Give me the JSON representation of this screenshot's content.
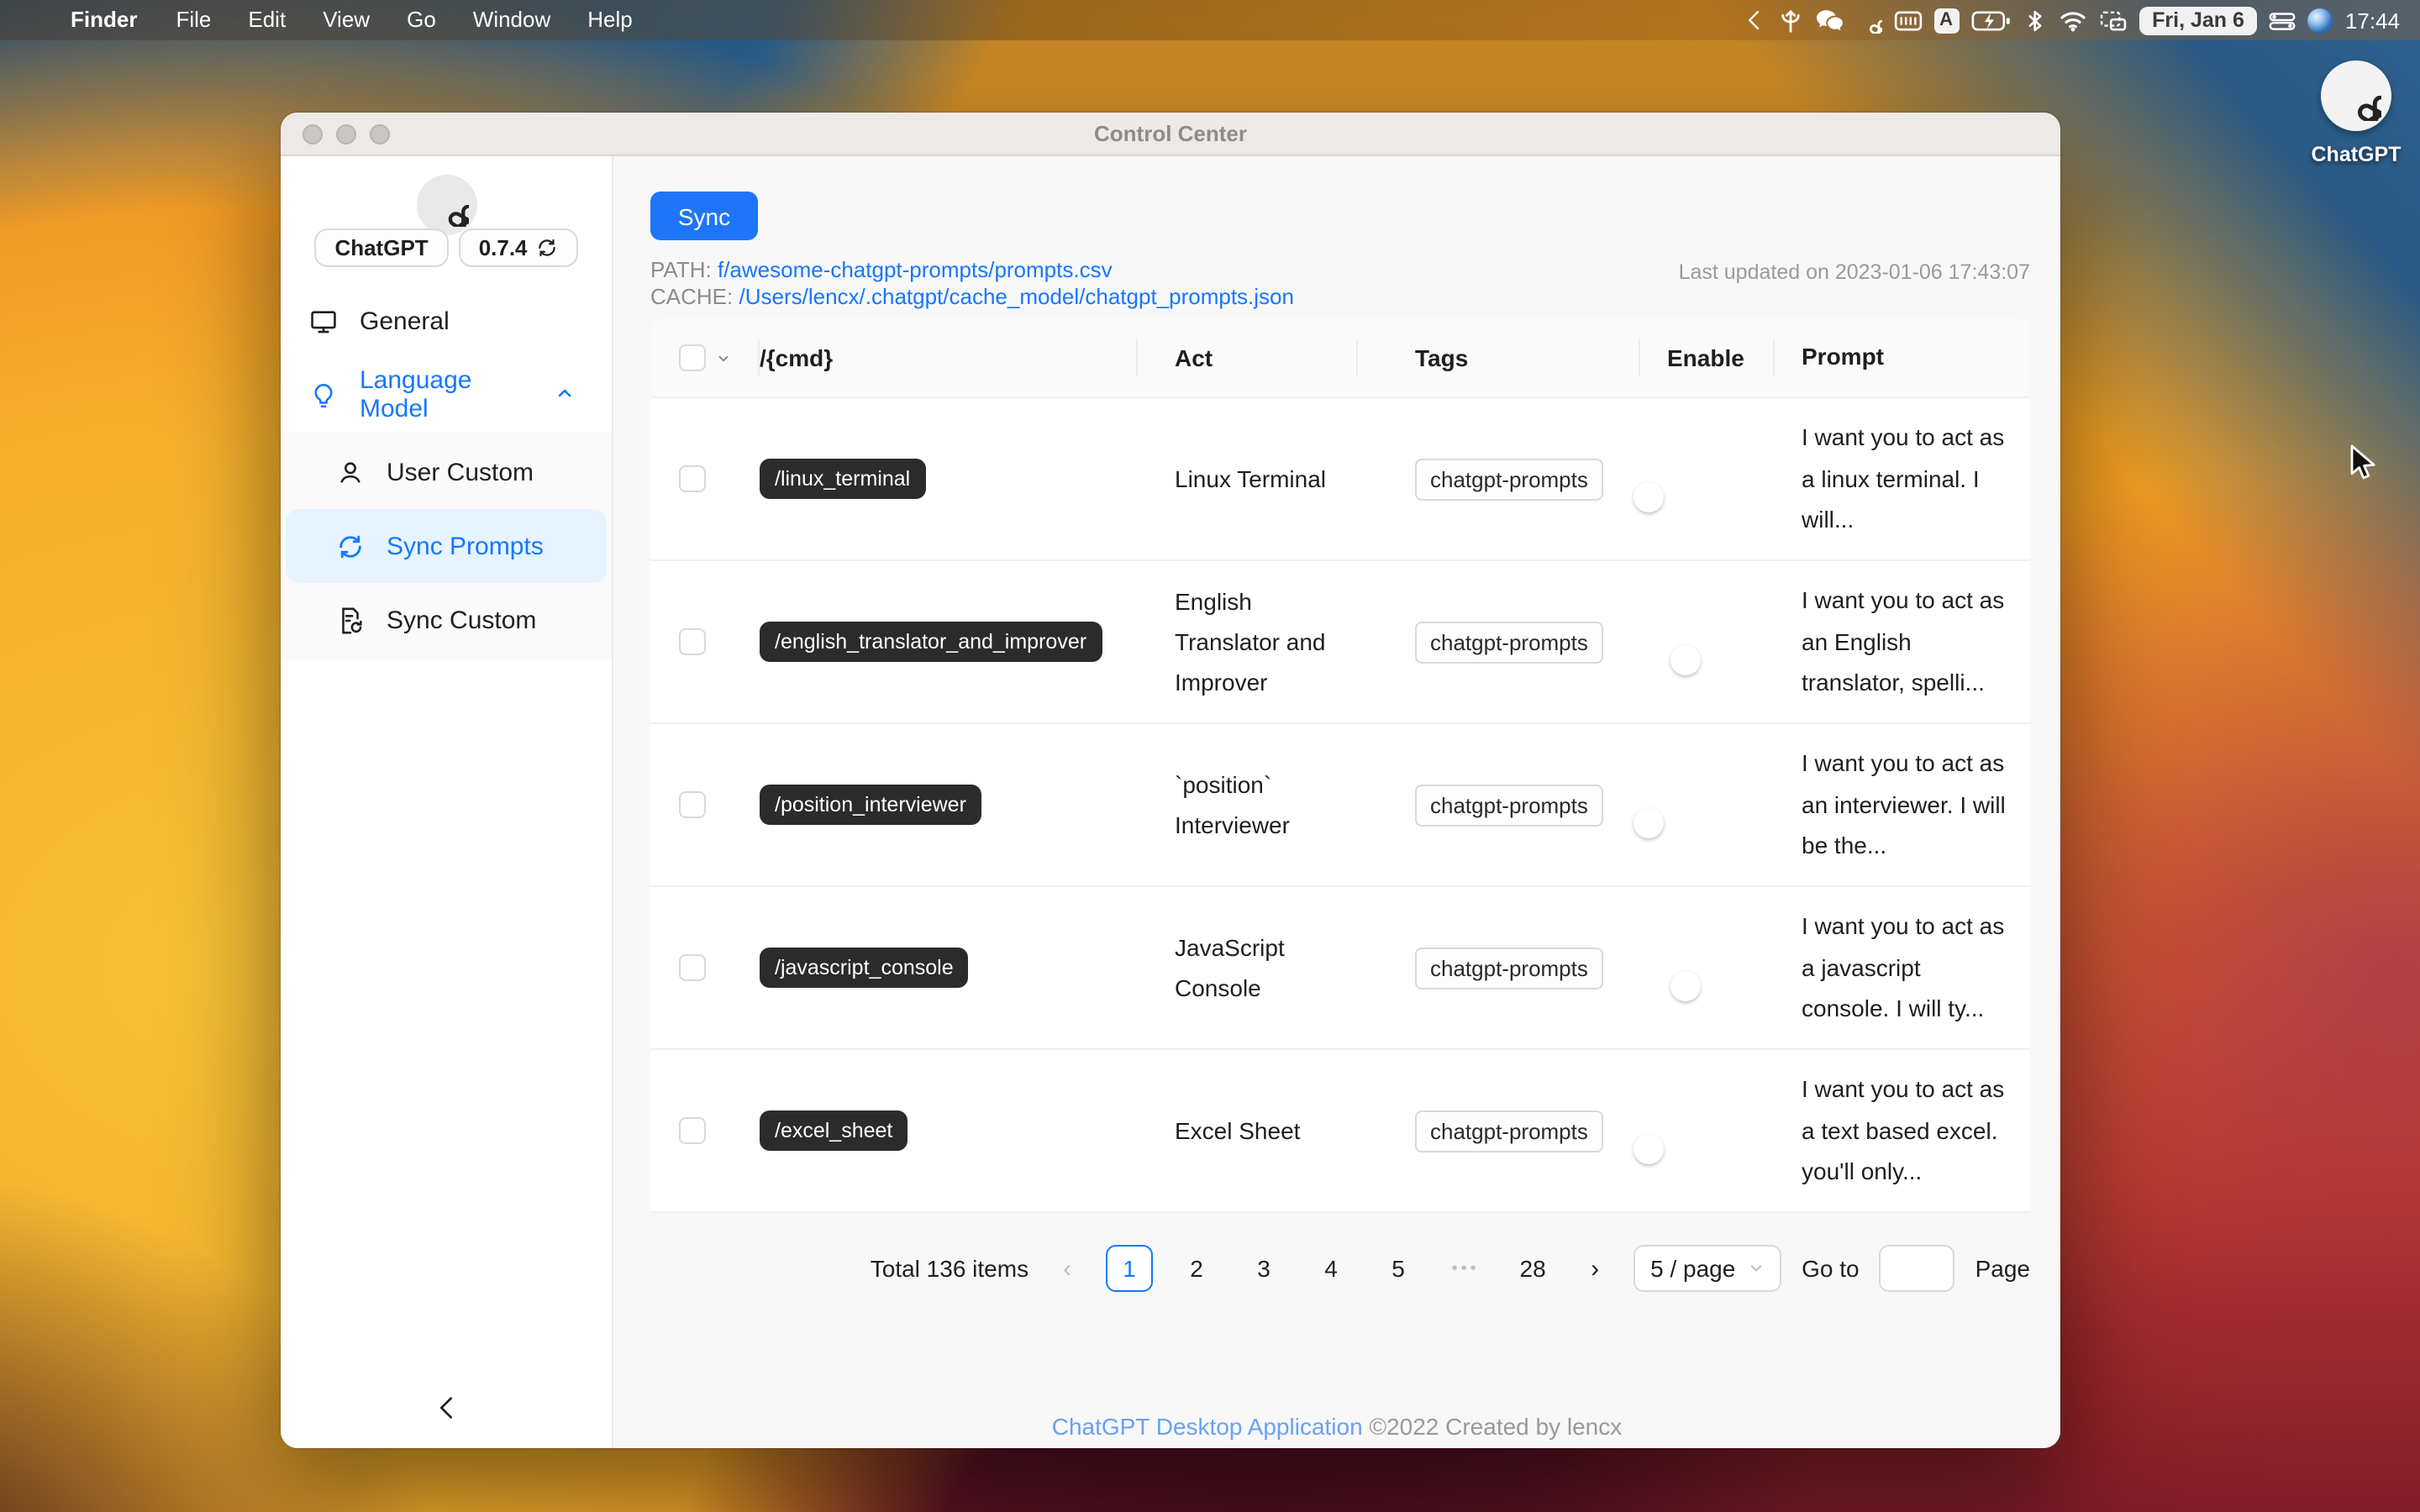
{
  "menu_bar": {
    "active_app": "Finder",
    "menus": [
      "File",
      "Edit",
      "View",
      "Go",
      "Window",
      "Help"
    ],
    "status_icons": [
      "chevron-left-icon",
      "sprout-icon",
      "wechat-icon",
      "openai-icon",
      "keyboard-icon",
      "input-source-icon",
      "battery-charging-icon",
      "bluetooth-icon",
      "wifi-icon",
      "screen-mirroring-icon",
      "control-center-icon",
      "globe-icon"
    ],
    "input_source_letter": "A",
    "date": "Fri, Jan 6",
    "time": "17:44"
  },
  "desktop": {
    "chatgpt_icon_label": "ChatGPT"
  },
  "window": {
    "title": "Control Center",
    "sidebar": {
      "app_badge": "ChatGPT",
      "version": "0.7.4",
      "items": [
        {
          "label": "General",
          "icon": "monitor"
        },
        {
          "label": "Language Model",
          "icon": "bulb",
          "expanded": true
        },
        {
          "label": "User Custom",
          "icon": "user"
        },
        {
          "label": "Sync Prompts",
          "icon": "sync",
          "active": true
        },
        {
          "label": "Sync Custom",
          "icon": "doc-sync"
        }
      ]
    },
    "content": {
      "sync_button": "Sync",
      "path_label": "PATH:",
      "path_value": "f/awesome-chatgpt-prompts/prompts.csv",
      "cache_label": "CACHE:",
      "cache_value": "/Users/lencx/.chatgpt/cache_model/chatgpt_prompts.json",
      "last_updated": "Last updated on 2023-01-06 17:43:07",
      "table": {
        "columns": {
          "cmd": "/{cmd}",
          "act": "Act",
          "tags": "Tags",
          "enable": "Enable",
          "prompt": "Prompt"
        },
        "rows": [
          {
            "cmd": "/linux_terminal",
            "act": "Linux Terminal",
            "tag": "chatgpt-prompts",
            "enabled": true,
            "prompt": "I want you to act as a linux terminal. I will..."
          },
          {
            "cmd": "/english_translator_and_improver",
            "act": "English Translator and Improver",
            "tag": "chatgpt-prompts",
            "enabled": false,
            "prompt": "I want you to act as an English translator, spelli..."
          },
          {
            "cmd": "/position_interviewer",
            "act": "`position` Interviewer",
            "tag": "chatgpt-prompts",
            "enabled": true,
            "prompt": "I want you to act as an interviewer. I will be the..."
          },
          {
            "cmd": "/javascript_console",
            "act": "JavaScript Console",
            "tag": "chatgpt-prompts",
            "enabled": false,
            "prompt": "I want you to act as a javascript console. I will ty..."
          },
          {
            "cmd": "/excel_sheet",
            "act": "Excel Sheet",
            "tag": "chatgpt-prompts",
            "enabled": true,
            "prompt": "I want you to act as a text based excel. you'll only..."
          }
        ]
      },
      "pagination": {
        "total": "Total 136 items",
        "prev": "‹",
        "next": "›",
        "current": "1",
        "pages": [
          "2",
          "3",
          "4",
          "5"
        ],
        "ellipsis": "•••",
        "last": "28",
        "size": "5 / page",
        "goto": "Go to",
        "page": "Page"
      },
      "footer": {
        "link": "ChatGPT Desktop Application",
        "suffix": "©2022 Created by lencx"
      }
    }
  },
  "colors": {
    "accent": "#1677ff",
    "sync_button": "#1f75f8",
    "active_nav_bg": "#e6f4ff",
    "toggle_on": "#1677ff",
    "toggle_off": "rgba(0,0,0,0.25)",
    "cmd_pill_bg": "#2b2b2b",
    "footer_link": "#69a1f4"
  }
}
